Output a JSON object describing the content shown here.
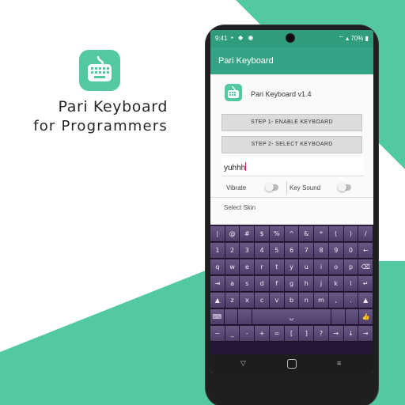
{
  "promo": {
    "title": "Pari Keyboard",
    "subtitle": "for Programmers"
  },
  "colors": {
    "accent": "#52c9a0",
    "app_bar": "#34a386",
    "status_bar": "#2e9c7d",
    "keyboard_key": "#5e4b78"
  },
  "status_bar": {
    "time": "9:41",
    "battery": "70%",
    "icons": [
      "notification-icon",
      "notification-icon",
      "notification-icon",
      "wifi-icon",
      "signal-icon",
      "battery-icon"
    ]
  },
  "app_bar": {
    "title": "Pari Keyboard"
  },
  "main": {
    "version_text": "Pari Keyboard v1.4",
    "step1_label": "STEP 1-  ENABLE KEYBOARD",
    "step2_label": "STEP 2-  SELECT KEYBOARD",
    "input_value": "yuhhh",
    "vibrate_label": "Vibrate",
    "keysound_label": "Key Sound",
    "select_skin_label": "Select Skin"
  },
  "keyboard": {
    "rows": [
      [
        "|",
        "@",
        "#",
        "$",
        "%",
        "^",
        "&",
        "*",
        "(",
        ")",
        "/"
      ],
      [
        "1",
        "2",
        "3",
        "4",
        "5",
        "6",
        "7",
        "8",
        "9",
        "0",
        "←"
      ],
      [
        "q",
        "w",
        "e",
        "r",
        "t",
        "y",
        "u",
        "i",
        "o",
        "p",
        "⌫"
      ],
      [
        "⇥",
        "a",
        "s",
        "d",
        "f",
        "g",
        "h",
        "j",
        "k",
        "l",
        "↵"
      ],
      [
        "▲",
        "z",
        "x",
        "c",
        "v",
        "b",
        "n",
        "m",
        ",",
        ".",
        "▲"
      ],
      [
        "⌨",
        "",
        "",
        "␣",
        "",
        "",
        "👍"
      ],
      [
        "~",
        "_",
        "-",
        "+",
        "=",
        "[",
        "]",
        "?",
        "→",
        "↓",
        "→"
      ]
    ]
  }
}
